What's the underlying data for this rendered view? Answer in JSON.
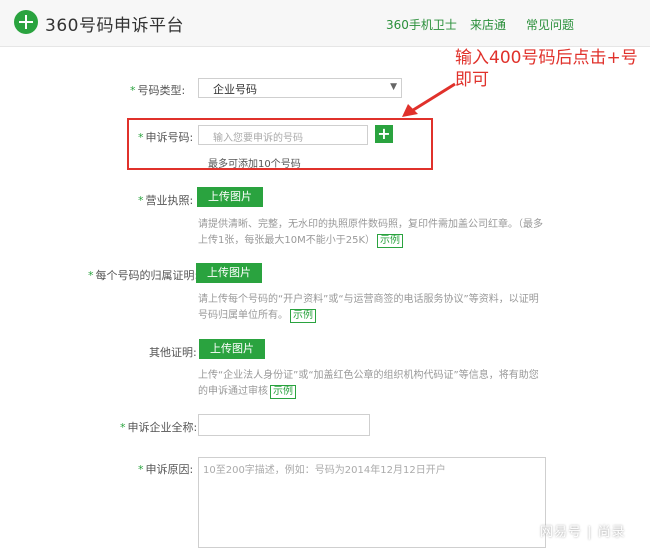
{
  "header": {
    "title": "360号码申诉平台",
    "nav": [
      "360手机卫士",
      "来店通",
      "常见问题"
    ]
  },
  "annotation": {
    "line1": "输入400号码后点击+号",
    "line2": "即可"
  },
  "form": {
    "star": "*",
    "number_type": {
      "label": "号码类型:",
      "value": "企业号码"
    },
    "appeal_number": {
      "label": "申诉号码:",
      "placeholder": "输入您要申诉的号码",
      "plus": "+",
      "note": "最多可添加10个号码"
    },
    "business_license": {
      "label": "营业执照:",
      "button": "上传图片",
      "help": "请提供清晰、完整，无水印的执照原件数码照，复印件需加盖公司红章。（最多上传1张，每张最大10M不能小于25K）",
      "example": "示例"
    },
    "ownership_proof": {
      "label": "每个号码的归属证明:",
      "button": "上传图片",
      "help": "请上传每个号码的“开户资料”或“与运营商签的电话服务协议”等资料，以证明号码归属单位所有。",
      "example": "示例"
    },
    "other_proof": {
      "label": "其他证明:",
      "button": "上传图片",
      "help": "上传“企业法人身份证”或“加盖红色公章的组织机构代码证”等信息，将有助您的申诉通过审核",
      "example": "示例"
    },
    "company_name": {
      "label": "申诉企业全称:"
    },
    "reason": {
      "label": "申诉原因:",
      "placeholder": "10至200字描述，例如：号码为2014年12月12日开户"
    }
  },
  "watermark": "网易号 | 尚录",
  "colors": {
    "accent": "#2aa33f",
    "annotation": "#e0312b"
  }
}
